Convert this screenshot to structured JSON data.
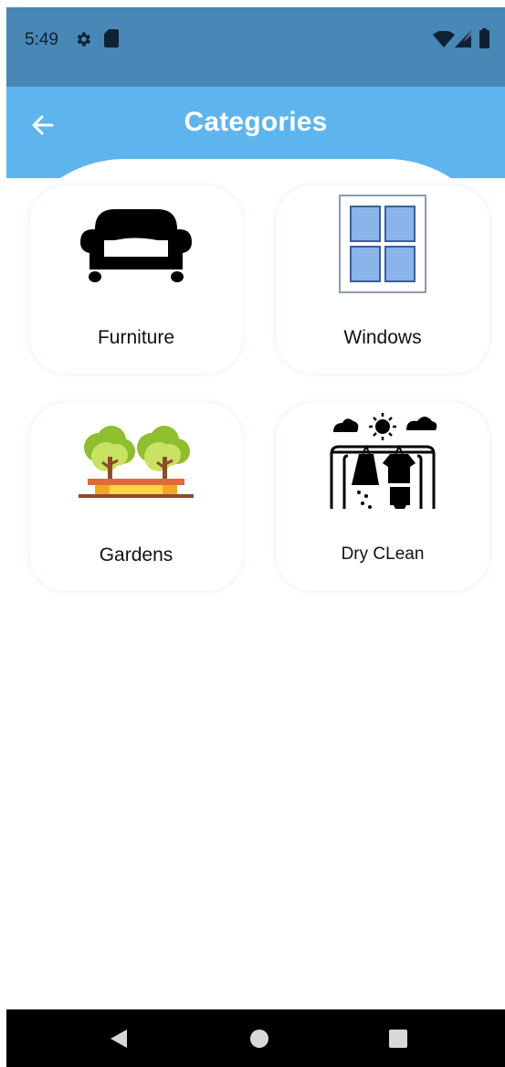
{
  "status_bar": {
    "time": "5:49",
    "icons": [
      "gear-icon",
      "sd-card-icon",
      "wifi-icon",
      "signal-icon",
      "battery-icon"
    ]
  },
  "app_bar": {
    "title": "Categories",
    "back_icon": "arrow-left-icon",
    "color": "#5eb5ed"
  },
  "categories": [
    {
      "label": "Furniture",
      "icon": "sofa-icon"
    },
    {
      "label": "Windows",
      "icon": "window-icon"
    },
    {
      "label": "Gardens",
      "icon": "garden-trees-icon"
    },
    {
      "label": "Dry CLean",
      "icon": "laundry-rack-icon"
    }
  ],
  "navigation": {
    "buttons": [
      "back-triangle-icon",
      "home-circle-icon",
      "recents-square-icon"
    ]
  },
  "colors": {
    "status_bar": "#4887b6",
    "app_bar": "#5eb5ed",
    "nav_bar": "#000000"
  }
}
